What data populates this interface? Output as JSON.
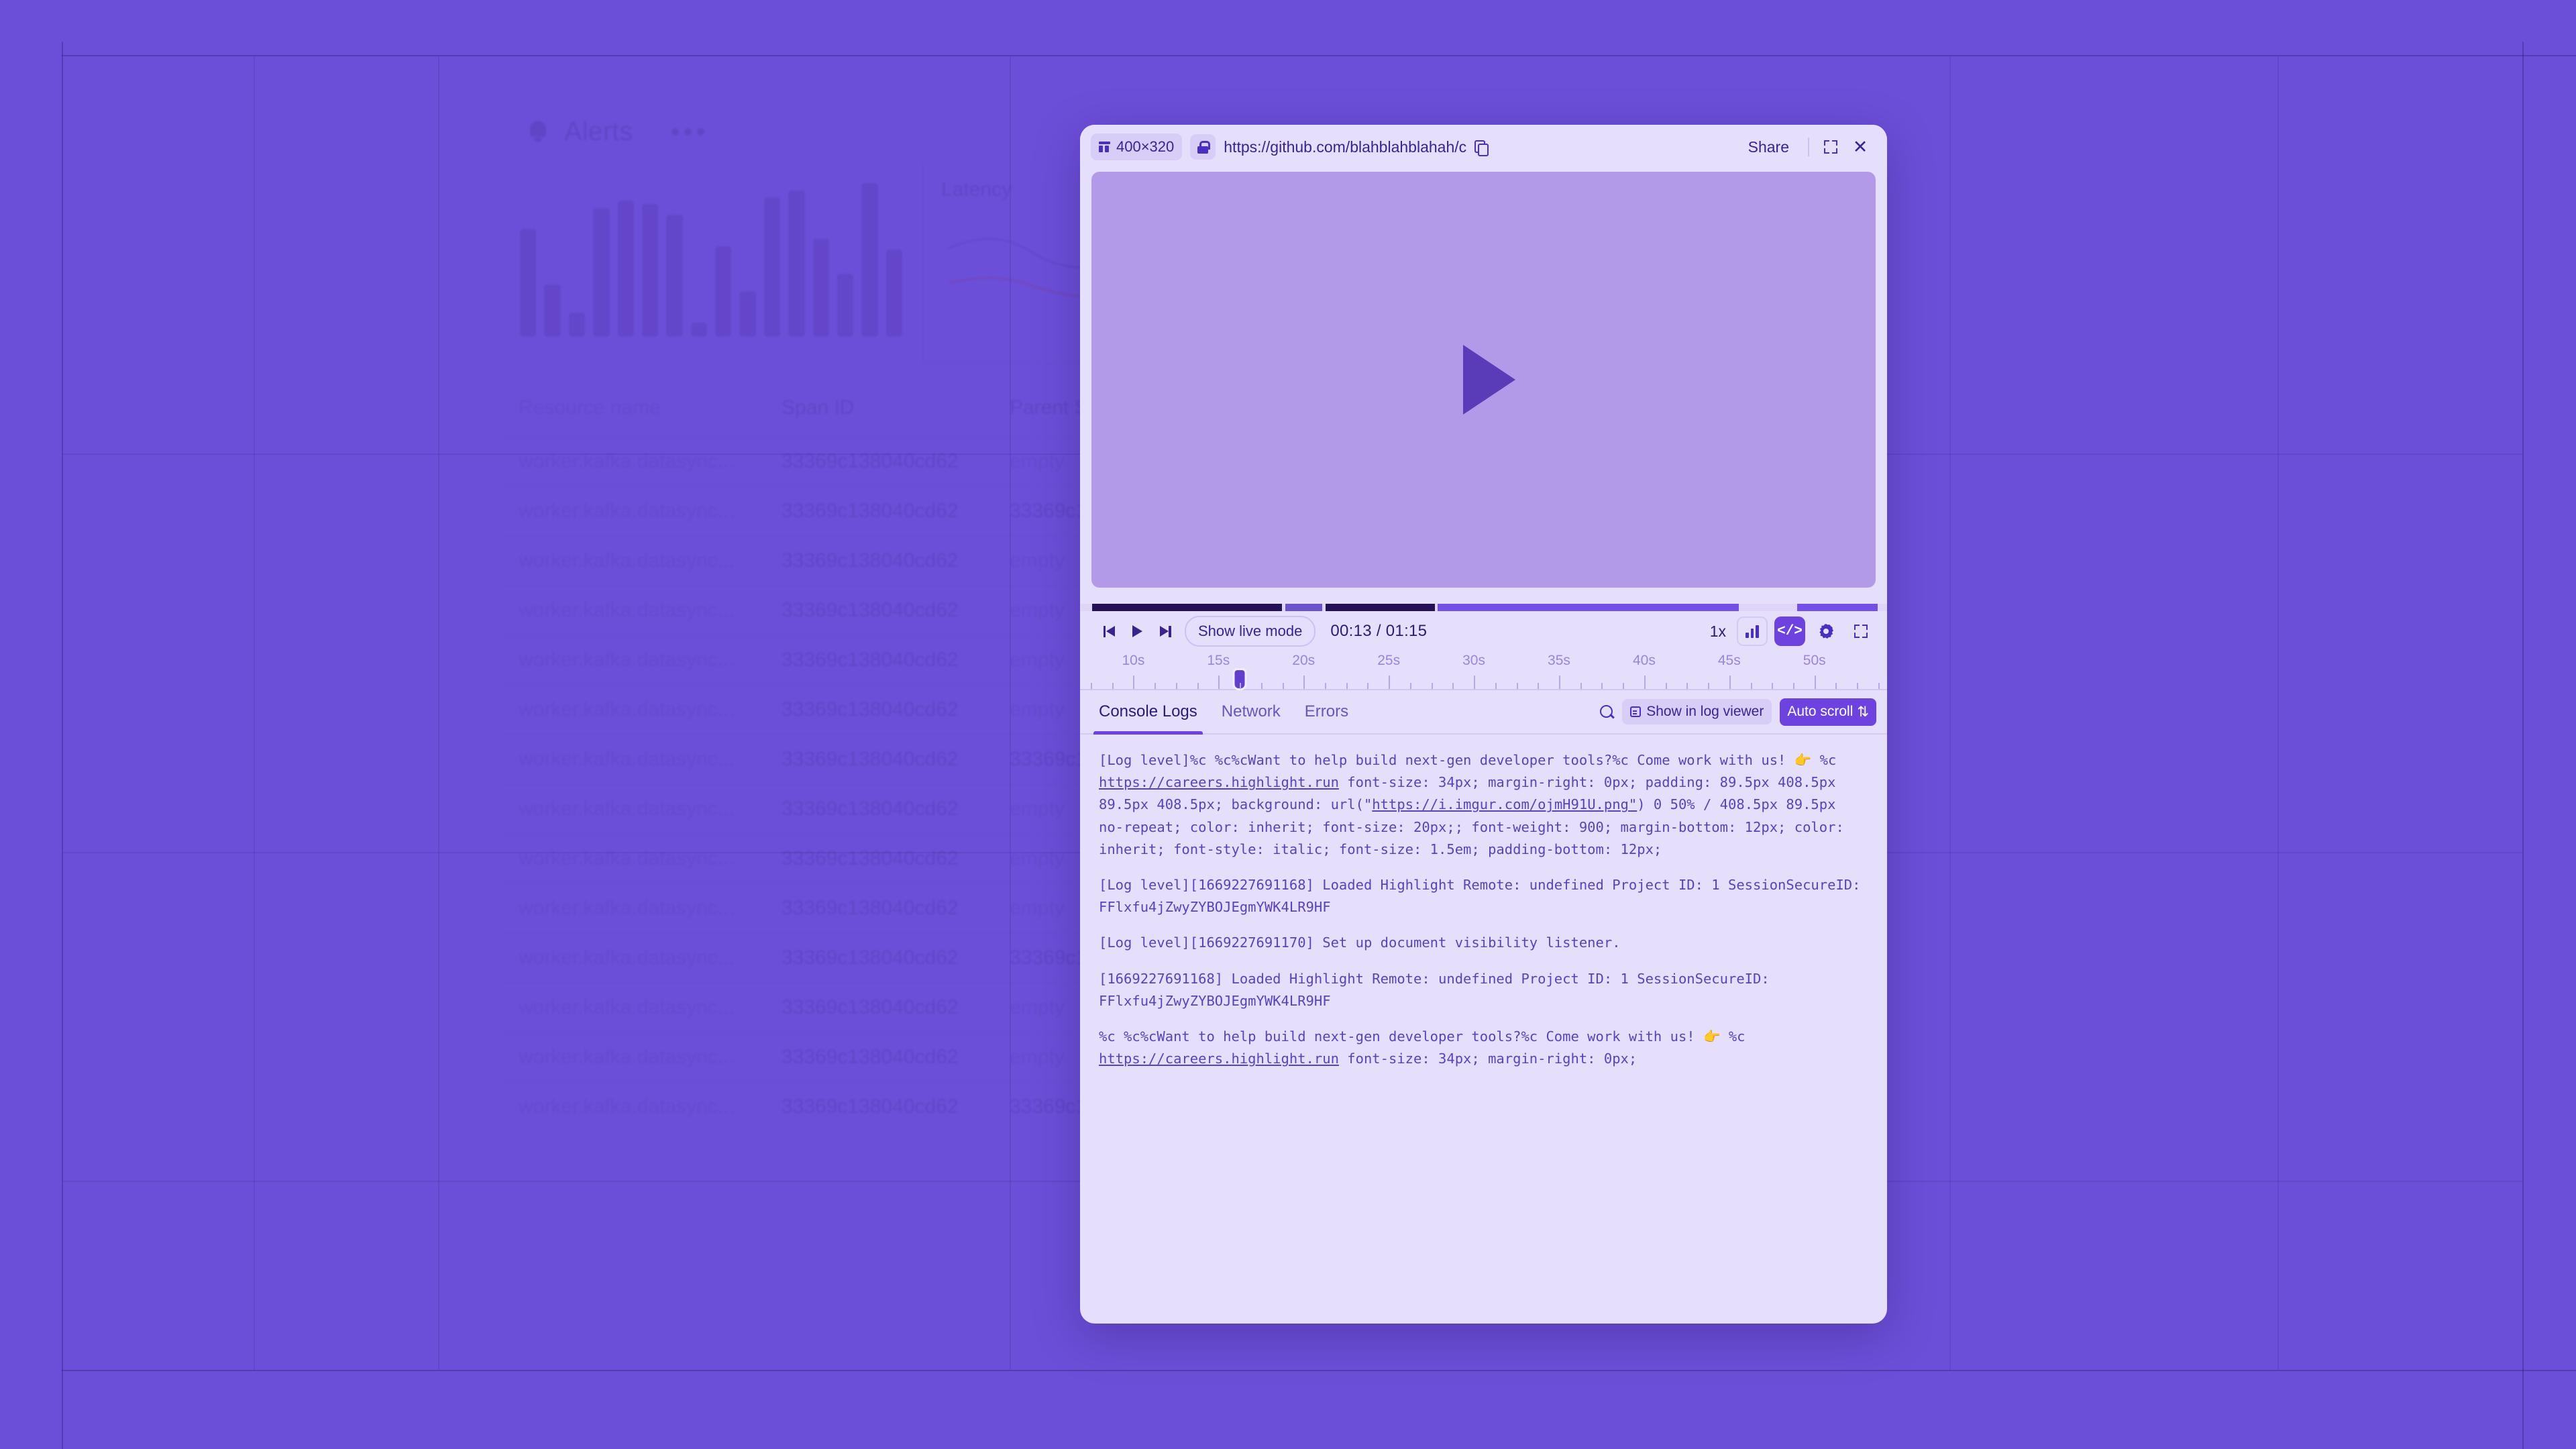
{
  "background": {
    "app_name": "session-dashboard",
    "header": {
      "title": "Alerts",
      "bell_icon": "bell-icon",
      "menu_icon": "ellipsis-icon"
    },
    "latency_panel": {
      "label": "Latency"
    },
    "bar_chart": {
      "values": [
        62,
        30,
        14,
        74,
        78,
        76,
        70,
        8,
        52,
        26,
        80,
        84,
        56,
        36,
        88,
        50
      ]
    },
    "table": {
      "columns": [
        "Resource name",
        "Span ID",
        "Parent Span ID"
      ],
      "rows": [
        {
          "resource": "worker.kafka.datasync...",
          "span": "33369c138040cd62",
          "parent": "empty"
        },
        {
          "resource": "worker.kafka.datasync...",
          "span": "33369c138040cd62",
          "parent": "33369c13804"
        },
        {
          "resource": "worker.kafka.datasync...",
          "span": "33369c138040cd62",
          "parent": "empty"
        },
        {
          "resource": "worker.kafka.datasync...",
          "span": "33369c138040cd62",
          "parent": "empty"
        },
        {
          "resource": "worker.kafka.datasync...",
          "span": "33369c138040cd62",
          "parent": "empty"
        },
        {
          "resource": "worker.kafka.datasync...",
          "span": "33369c138040cd62",
          "parent": "empty"
        },
        {
          "resource": "worker.kafka.datasync...",
          "span": "33369c138040cd62",
          "parent": "33369c13804"
        },
        {
          "resource": "worker.kafka.datasync...",
          "span": "33369c138040cd62",
          "parent": "empty"
        },
        {
          "resource": "worker.kafka.datasync...",
          "span": "33369c138040cd62",
          "parent": "empty"
        },
        {
          "resource": "worker.kafka.datasync...",
          "span": "33369c138040cd62",
          "parent": "empty"
        },
        {
          "resource": "worker.kafka.datasync...",
          "span": "33369c138040cd62",
          "parent": "33369c13804"
        },
        {
          "resource": "worker.kafka.datasync...",
          "span": "33369c138040cd62",
          "parent": "empty"
        },
        {
          "resource": "worker.kafka.datasync...",
          "span": "33369c138040cd62",
          "parent": "empty"
        },
        {
          "resource": "worker.kafka.datasync...",
          "span": "33369c138040cd62",
          "parent": "33369c13804"
        }
      ]
    }
  },
  "modal": {
    "toolbar": {
      "viewport_icon": "viewport-icon",
      "viewport_size": "400×320",
      "lock_icon": "lock-icon",
      "url": "https://github.com/blahblahblahah/c",
      "copy_icon": "copy-icon",
      "share_label": "Share",
      "expand_icon": "expand-icon",
      "close_icon": "✕"
    },
    "player": {
      "play_overlay_icon": "play-icon",
      "prev_icon": "skip-back-icon",
      "play_icon": "play-icon",
      "next_icon": "skip-forward-icon",
      "live_mode_label": "Show live mode",
      "time_display": "00:13 / 01:15",
      "current_time": "00:13",
      "total_time": "01:15",
      "speed_label": "1x",
      "bars_icon": "bar-chart-icon",
      "code_icon": "</>",
      "gear_icon": "gear-icon",
      "fullscreen_icon": "fullscreen-icon",
      "progress_segments": [
        {
          "left_pct": 1.5,
          "width_pct": 23.5,
          "color": "#241155"
        },
        {
          "left_pct": 25.4,
          "width_pct": 4.6,
          "color": "#6d52cd"
        },
        {
          "left_pct": 30.4,
          "width_pct": 13.6,
          "color": "#241155"
        },
        {
          "left_pct": 44.3,
          "width_pct": 37.3,
          "color": "#7350e8"
        },
        {
          "left_pct": 82.0,
          "width_pct": 6.7,
          "color": "#ded5f9"
        },
        {
          "left_pct": 88.9,
          "width_pct": 9.9,
          "color": "#7350e8"
        }
      ],
      "timeline": {
        "ticks": [
          "10s",
          "15s",
          "20s",
          "25s",
          "30s",
          "35s",
          "40s",
          "45s",
          "50s"
        ],
        "scrubber_position_pct": 19.8
      }
    },
    "tabs": [
      {
        "label": "Console Logs",
        "active": true
      },
      {
        "label": "Network",
        "active": false
      },
      {
        "label": "Errors",
        "active": false
      }
    ],
    "tab_actions": {
      "search_icon": "search-icon",
      "log_viewer_icon": "panel-icon",
      "log_viewer_label": "Show in log viewer",
      "autoscroll_label": "Auto scroll",
      "autoscroll_icon": "⇅"
    },
    "console_logs": [
      {
        "parts": [
          {
            "t": "[Log level]%c %c%cWant to help build next-gen developer tools?%c Come work with us! 👉 %c ",
            "link": false
          },
          {
            "t": "https://careers.highlight.run",
            "link": true
          },
          {
            "t": " font-size: 34px; margin-right: 0px; padding: 89.5px 408.5px 89.5px 408.5px; background: url(\"",
            "link": false
          },
          {
            "t": "https://i.imgur.com/ojmH91U.png\"",
            "link": true
          },
          {
            "t": ") 0 50% / 408.5px 89.5px no-repeat; color: inherit; font-size: 20px;; font-weight: 900; margin-bottom: 12px; color: inherit; font-style: italic; font-size: 1.5em; padding-bottom: 12px;",
            "link": false
          }
        ]
      },
      {
        "parts": [
          {
            "t": "[Log level][1669227691168] Loaded Highlight Remote: undefined Project ID: 1 SessionSecureID: FFlxfu4jZwyZYBOJEgmYWK4LR9HF",
            "link": false
          }
        ]
      },
      {
        "parts": [
          {
            "t": "[Log level][1669227691170] Set up document visibility listener.",
            "link": false
          }
        ]
      },
      {
        "parts": [
          {
            "t": "[1669227691168] Loaded Highlight Remote: undefined Project ID: 1 SessionSecureID: FFlxfu4jZwyZYBOJEgmYWK4LR9HF",
            "link": false
          }
        ]
      },
      {
        "parts": [
          {
            "t": "%c %c%cWant to help build next-gen developer tools?%c Come work with us! 👉 %c ",
            "link": false
          },
          {
            "t": "https://careers.highlight.run",
            "link": true
          },
          {
            "t": " font-size: 34px; margin-right: 0px;",
            "link": false
          }
        ]
      }
    ]
  },
  "colors": {
    "page_background": "#6c4fd8",
    "modal_background": "#e6dffb",
    "accent": "#6d42de",
    "video_stage": "#b29ae8",
    "text_primary": "#2d1a73",
    "text_secondary": "#6b56b8",
    "log_text": "#5b43b5"
  }
}
